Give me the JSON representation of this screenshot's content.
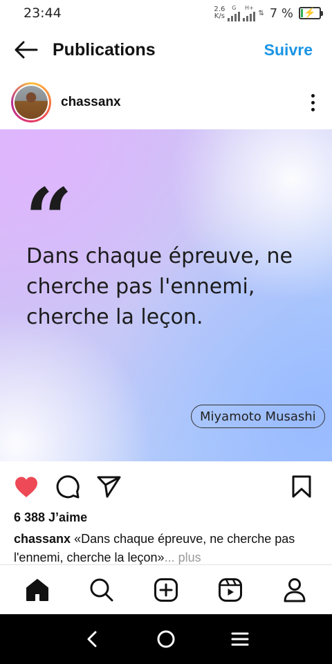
{
  "status_bar": {
    "time": "23:44",
    "net_speed_value": "2.6",
    "net_speed_unit": "K/s",
    "sim1_tag": "G",
    "sim2_tag": "H+",
    "battery_percent": "7 %"
  },
  "header": {
    "title": "Publications",
    "follow_label": "Suivre"
  },
  "post": {
    "username": "chassanx",
    "quote_mark": "“",
    "quote_text": "Dans chaque épreuve, ne cherche pas l'ennemi, cherche la leçon.",
    "author": "Miyamoto Musashi",
    "likes": "6 388 J’aime",
    "caption_user": "chassanx",
    "caption_text": " «Dans chaque épreuve, ne cherche pas l'ennemi, cherche la leçon»",
    "caption_more": "... plus"
  },
  "colors": {
    "like_red": "#ed4956",
    "link_blue": "#1a95e6"
  },
  "icons": {
    "like": "heart-icon",
    "comment": "comment-icon",
    "share": "send-icon",
    "save": "bookmark-icon",
    "home": "home-icon",
    "search": "search-icon",
    "create": "plus-square-icon",
    "reels": "reels-icon",
    "profile": "profile-icon"
  }
}
